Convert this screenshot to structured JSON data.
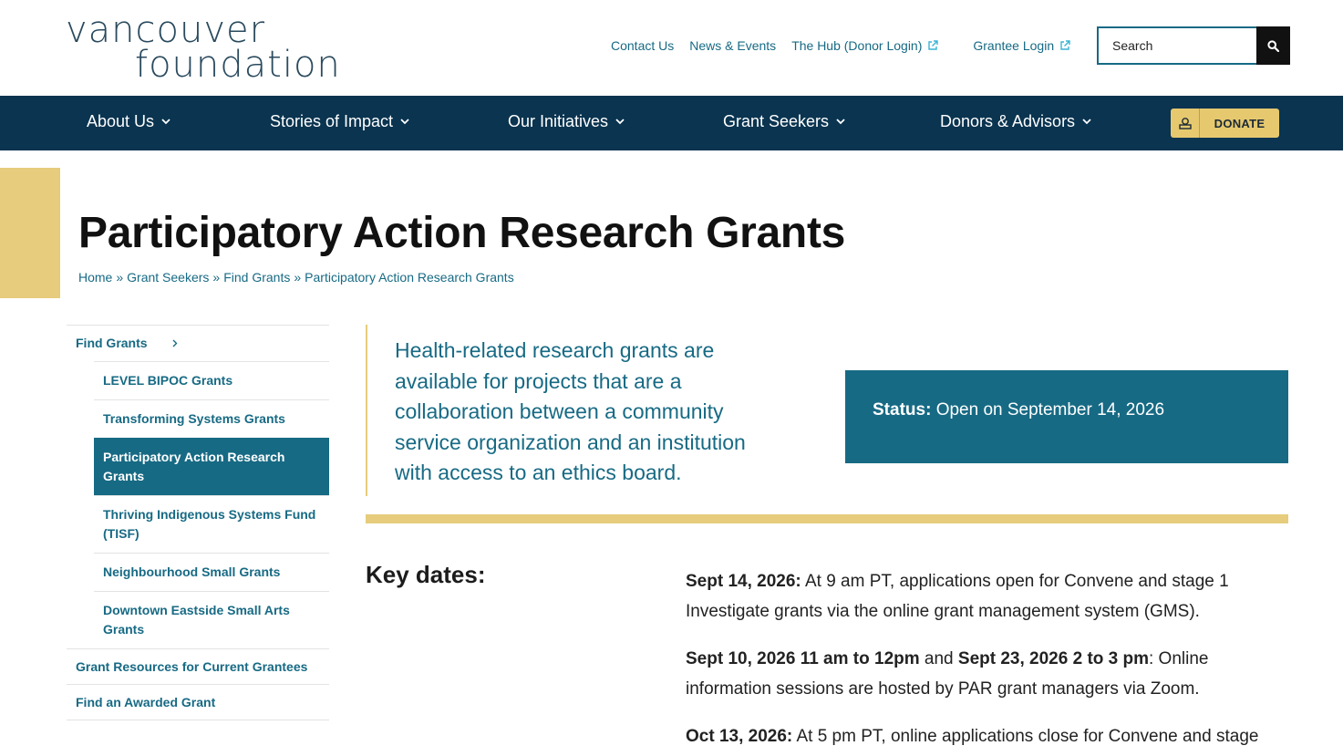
{
  "logo": {
    "line1": "vancouver",
    "line2": "foundation"
  },
  "top_links": [
    {
      "label": "Contact Us",
      "external": false
    },
    {
      "label": "News & Events",
      "external": false
    },
    {
      "label": "The Hub (Donor Login)",
      "external": true
    },
    {
      "label": "Grantee Login",
      "external": true
    }
  ],
  "search": {
    "placeholder": "Search"
  },
  "nav": {
    "items": [
      "About Us",
      "Stories of Impact",
      "Our Initiatives",
      "Grant Seekers",
      "Donors & Advisors"
    ],
    "donate_label": "DONATE"
  },
  "colors": {
    "nav_bg": "#0a3450",
    "teal": "#176a84",
    "gold": "#e6cc7c"
  },
  "page": {
    "title": "Participatory Action Research Grants",
    "breadcrumb": [
      "Home",
      "Grant Seekers",
      "Find Grants",
      "Participatory Action Research Grants"
    ],
    "breadcrumb_separator": "»"
  },
  "sidebar": {
    "parent": "Find Grants",
    "children": [
      {
        "label": "LEVEL BIPOC Grants",
        "active": false
      },
      {
        "label": "Transforming Systems Grants",
        "active": false
      },
      {
        "label": "Participatory Action Research Grants",
        "active": true
      },
      {
        "label": "Thriving Indigenous Systems Fund (TISF)",
        "active": false
      },
      {
        "label": "Neighbourhood Small Grants",
        "active": false
      },
      {
        "label": "Downtown Eastside Small Arts Grants",
        "active": false
      }
    ],
    "others": [
      "Grant Resources for Current Grantees",
      "Find an Awarded Grant"
    ]
  },
  "intro": "Health-related research grants are available for projects that are a collaboration between a community service organization and an institution with access to an ethics board.",
  "status": {
    "label": "Status:",
    "value": "Open on September 14, 2026"
  },
  "key_dates": {
    "heading": "Key dates:",
    "items": [
      {
        "date": "Sept 14, 2026:",
        "text": " At 9 am PT, applications open for Convene and stage 1 Investigate grants via the online grant management system (GMS)."
      },
      {
        "date": "Sept 10, 2026 11 am to 12pm",
        "middle": " and ",
        "date2": "Sept 23, 2026 2 to 3 pm",
        "text": ": Online information sessions are hosted by PAR grant managers via Zoom."
      },
      {
        "date": "Oct 13, 2026:",
        "text": " At 5 pm PT, online applications close for Convene and stage"
      }
    ]
  }
}
